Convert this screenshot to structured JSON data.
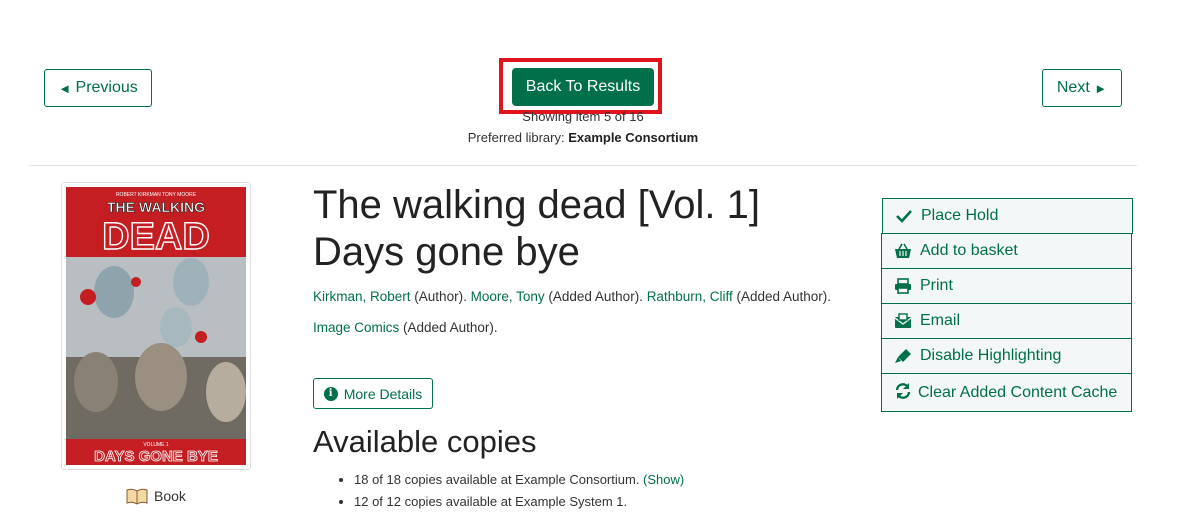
{
  "nav": {
    "previous_label": "Previous",
    "previous_arrow": "◄",
    "back_label": "Back To Results",
    "next_label": "Next",
    "next_arrow": "►",
    "showing_text": "Showing item 5 of 16",
    "preferred_prefix": "Preferred library: ",
    "preferred_library": "Example Consortium"
  },
  "record": {
    "title_line1": "The walking dead [Vol. 1]",
    "title_line2": "Days gone bye",
    "authors": [
      {
        "name": "Kirkman, Robert",
        "role": " (Author). "
      },
      {
        "name": "Moore, Tony",
        "role": " (Added Author). "
      },
      {
        "name": "Rathburn, Cliff",
        "role": " (Added Author)."
      },
      {
        "name": "Image Comics",
        "role": " (Added Author)."
      }
    ],
    "format": "Book",
    "more_details_label": "More Details",
    "cover": {
      "top_credit": "ROBERT KIRKMAN  TONY MOORE",
      "series_line1": "THE WALKING",
      "series_line2": "DEAD",
      "volume": "VOLUME 1",
      "subtitle": "DAYS GONE BYE"
    }
  },
  "availability": {
    "heading": "Available copies",
    "copies": [
      {
        "text": "18 of 18 copies available at Example Consortium. ",
        "link": "(Show)"
      },
      {
        "text": "12 of 12 copies available at Example System 1.",
        "link": ""
      }
    ]
  },
  "actions": [
    {
      "label": "Place Hold",
      "icon": "check-icon"
    },
    {
      "label": "Add to basket",
      "icon": "basket-icon"
    },
    {
      "label": "Print",
      "icon": "print-icon"
    },
    {
      "label": "Email",
      "icon": "email-icon"
    },
    {
      "label": "Disable Highlighting",
      "icon": "highlighter-icon"
    },
    {
      "label": "Clear Added Content Cache",
      "icon": "refresh-icon"
    }
  ],
  "colors": {
    "primary": "#00704a",
    "highlight": "#e0141e"
  }
}
